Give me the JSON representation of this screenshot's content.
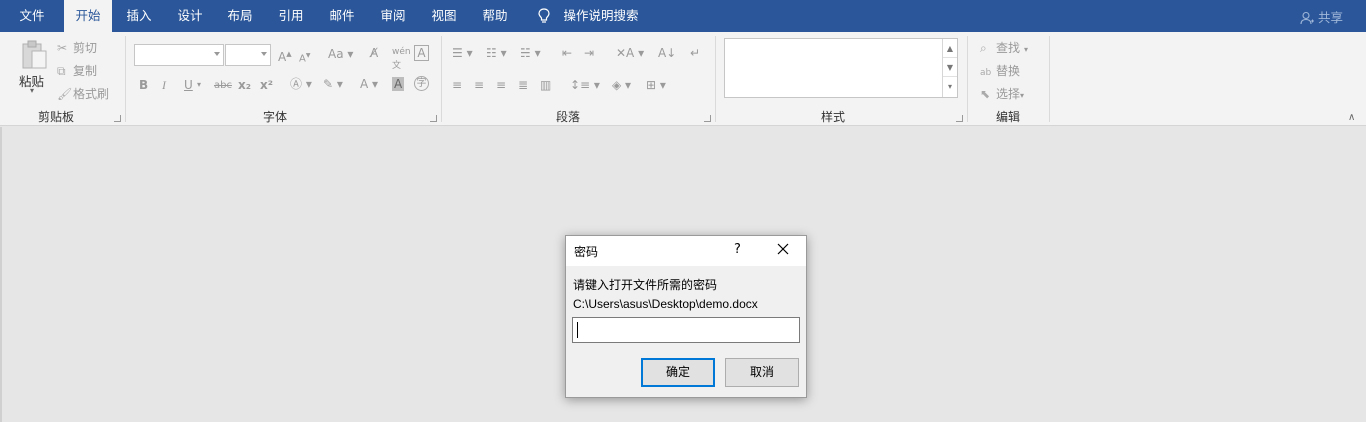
{
  "menu": {
    "tabs": [
      "文件",
      "开始",
      "插入",
      "设计",
      "布局",
      "引用",
      "邮件",
      "审阅",
      "视图",
      "帮助"
    ],
    "active_tab": "开始",
    "search_label": "操作说明搜索",
    "share_label": "共享",
    "bar_color": "#2b579a"
  },
  "ribbon": {
    "clipboard": {
      "paste": "粘贴",
      "cut": "剪切",
      "copy": "复制",
      "format_painter": "格式刷",
      "group_label": "剪贴板"
    },
    "font": {
      "group_label": "字体",
      "font_name": "",
      "font_size": "",
      "bold": "B",
      "italic": "I",
      "underline": "U",
      "strikethrough": "abc",
      "subscript": "x₂",
      "superscript": "x²"
    },
    "paragraph": {
      "group_label": "段落"
    },
    "styles": {
      "group_label": "样式"
    },
    "editing": {
      "group_label": "编辑",
      "find": "查找",
      "replace": "替换",
      "select": "选择"
    }
  },
  "dialog": {
    "title": "密码",
    "help": "?",
    "prompt": "请键入打开文件所需的密码",
    "file_path": "C:\\Users\\asus\\Desktop\\demo.docx",
    "password_value": "",
    "ok_label": "确定",
    "cancel_label": "取消",
    "accent_color": "#0078d7"
  }
}
